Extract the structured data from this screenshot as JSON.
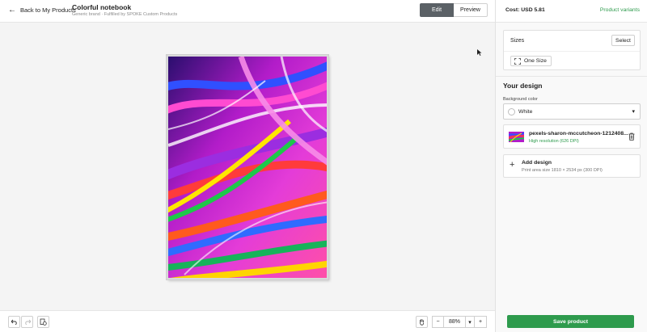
{
  "header": {
    "back_label": "Back to My Products",
    "product_title": "Colorful notebook",
    "product_subtitle": "Generic brand · Fulfilled by SPOKE Custom Products",
    "edit_label": "Edit",
    "preview_label": "Preview"
  },
  "panel": {
    "cost": "Cost: USD 5.81",
    "variants_link": "Product variants",
    "sizes": {
      "label": "Sizes",
      "select_label": "Select",
      "chip_label": "One Size"
    },
    "design": {
      "heading": "Your design",
      "bg_label": "Background color",
      "bg_value": "White",
      "layer_name": "pexels-sharon-mccutcheon-1212408...",
      "layer_resolution": "High resolution (626 DPI)",
      "add_title": "Add design",
      "add_subtitle": "Print area size 1810 × 2534 px (300 DPI)"
    },
    "save_label": "Save product"
  },
  "toolbar": {
    "zoom_value": "88%",
    "zoom_minus": "−",
    "zoom_plus": "+",
    "zoom_caret": "▾"
  },
  "icons": {
    "back": "arrow-left-icon",
    "undo": "undo-icon",
    "redo": "redo-icon",
    "layers": "layers-icon",
    "pan": "hand-icon",
    "size": "expand-icon",
    "trash": "trash-icon"
  },
  "colors": {
    "accent_green": "#2e9b4d",
    "active_toggle": "#5b6166"
  }
}
